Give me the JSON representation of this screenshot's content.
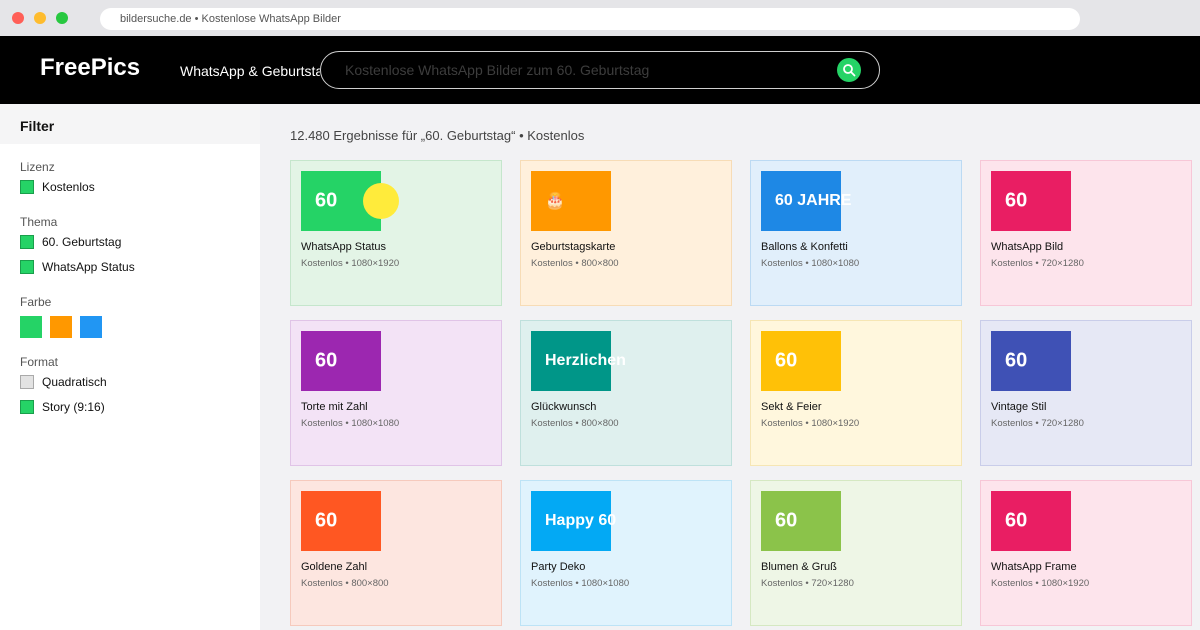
{
  "browser": {
    "url": "bildersuche.de • Kostenlose WhatsApp Bilder"
  },
  "header": {
    "logo": "FreePics",
    "nav_link": "WhatsApp & Geburtstag",
    "search_placeholder": "Kostenlose WhatsApp Bilder zum 60. Geburtstag",
    "search_icon": "search-icon"
  },
  "sidebar": {
    "title": "Filter",
    "license": {
      "label": "Lizenz",
      "options": [
        {
          "label": "Kostenlos",
          "checked": true
        }
      ]
    },
    "theme": {
      "label": "Thema",
      "options": [
        {
          "label": "60. Geburtstag",
          "checked": true
        },
        {
          "label": "WhatsApp Status",
          "checked": true
        }
      ]
    },
    "color": {
      "label": "Farbe",
      "swatches": [
        "#25d366",
        "#ff9800",
        "#2196f3"
      ]
    },
    "format": {
      "label": "Format",
      "options": [
        {
          "label": "Quadratisch",
          "checked": false
        },
        {
          "label": "Story (9:16)",
          "checked": true
        }
      ]
    }
  },
  "results": {
    "summary": "12.480 Ergebnisse für „60. Geburtstag“ • Kostenlos",
    "cards": [
      {
        "thumb_text": "60",
        "title": "WhatsApp Status",
        "meta": "Kostenlos • 1080×1920",
        "thumb_color": "#25d366",
        "bg": "#e3f4e6",
        "border": "#c5e6cc"
      },
      {
        "thumb_text": "🎂",
        "title": "Geburtstagskarte",
        "meta": "Kostenlos • 800×800",
        "thumb_color": "#ff9800",
        "bg": "#fff0dc",
        "border": "#f7dcb6"
      },
      {
        "thumb_text": "60 JAHRE",
        "title": "Ballons & Konfetti",
        "meta": "Kostenlos • 1080×1080",
        "thumb_color": "#1e88e5",
        "bg": "#e1effb",
        "border": "#bcdaf3"
      },
      {
        "thumb_text": "60",
        "title": "WhatsApp Bild",
        "meta": "Kostenlos • 720×1280",
        "thumb_color": "#e91e63",
        "bg": "#fde4ec",
        "border": "#f7c7d7"
      },
      {
        "thumb_text": "60",
        "title": "Torte mit Zahl",
        "meta": "Kostenlos • 1080×1080",
        "thumb_color": "#9c27b0",
        "bg": "#f3e3f6",
        "border": "#e0c4e7"
      },
      {
        "thumb_text": "Herzlichen",
        "title": "Glückwunsch",
        "meta": "Kostenlos • 800×800",
        "thumb_color": "#009688",
        "bg": "#dff0ee",
        "border": "#bfe0dc"
      },
      {
        "thumb_text": "60",
        "title": "Sekt & Feier",
        "meta": "Kostenlos • 1080×1920",
        "thumb_color": "#ffc107",
        "bg": "#fff7dd",
        "border": "#f6e6b4"
      },
      {
        "thumb_text": "60",
        "title": "Vintage Stil",
        "meta": "Kostenlos • 720×1280",
        "thumb_color": "#3f51b5",
        "bg": "#e6e8f5",
        "border": "#c9cde9"
      },
      {
        "thumb_text": "60",
        "title": "Goldene Zahl",
        "meta": "Kostenlos • 800×800",
        "thumb_color": "#ff5722",
        "bg": "#fde6e0",
        "border": "#f6cabd"
      },
      {
        "thumb_text": "Happy 60",
        "title": "Party Deko",
        "meta": "Kostenlos • 1080×1080",
        "thumb_color": "#03a9f4",
        "bg": "#e0f3fd",
        "border": "#bde3f6"
      },
      {
        "thumb_text": "60",
        "title": "Blumen & Gruß",
        "meta": "Kostenlos • 720×1280",
        "thumb_color": "#8bc34a",
        "bg": "#eef6e6",
        "border": "#d5e8c2"
      },
      {
        "thumb_text": "60",
        "title": "WhatsApp Frame",
        "meta": "Kostenlos • 1080×1920",
        "thumb_color": "#e91e63",
        "bg": "#fde4ec",
        "border": "#f7c7d7"
      }
    ]
  }
}
